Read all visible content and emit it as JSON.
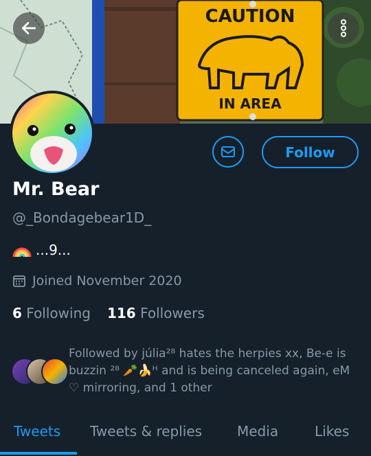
{
  "header": {
    "back_icon": "arrow-left-icon",
    "more_icon": "more-vertical-icon",
    "banner_sign": {
      "top_text": "CAUTION",
      "bottom_text": "IN AREA"
    }
  },
  "profile": {
    "display_name": "Mr. Bear",
    "handle": "@_Bondagebear1D_",
    "bio_text": "...9...",
    "joined": "Joined November 2020",
    "following_count": "6",
    "following_label": "Following",
    "followers_count": "116",
    "followers_label": "Followers"
  },
  "actions": {
    "message_icon": "mail-icon",
    "follow_label": "Follow"
  },
  "followed_by": {
    "text": "Followed by júlia²⁸ hates the herpies xx, Be-e is buzzin ²⁸ 🥕🍌ᴴ and is being canceled again, eM ♡ mirroring, and 1 other"
  },
  "tabs": [
    {
      "label": "Tweets",
      "active": true
    },
    {
      "label": "Tweets & replies",
      "active": false
    },
    {
      "label": "Media",
      "active": false
    },
    {
      "label": "Likes",
      "active": false
    }
  ],
  "colors": {
    "accent": "#1d9bf0",
    "background": "#15202b",
    "secondary_text": "#8899a6",
    "sign_yellow": "#f4b300"
  }
}
